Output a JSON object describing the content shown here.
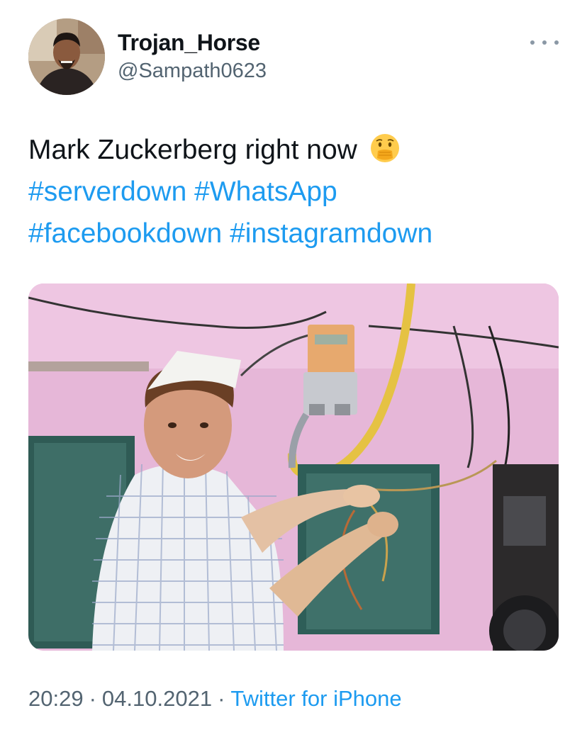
{
  "author": {
    "display_name": "Trojan_Horse",
    "handle": "@Sampath0623"
  },
  "tweet": {
    "text": "Mark Zuckerberg right now",
    "emoji": "face-with-hand-over-mouth",
    "hashtags": [
      "#serverdown",
      "#WhatsApp",
      "#facebookdown",
      "#instagramdown"
    ]
  },
  "media": {
    "type": "photo"
  },
  "meta": {
    "time": "20:29",
    "separator": "·",
    "date": "04.10.2021",
    "source": "Twitter for iPhone"
  },
  "colors": {
    "link": "#1d9bf0",
    "secondary_text": "#536471",
    "primary_text": "#0f1419",
    "background": "#ffffff"
  },
  "icons": {
    "more": "more-horizontal-icon"
  }
}
